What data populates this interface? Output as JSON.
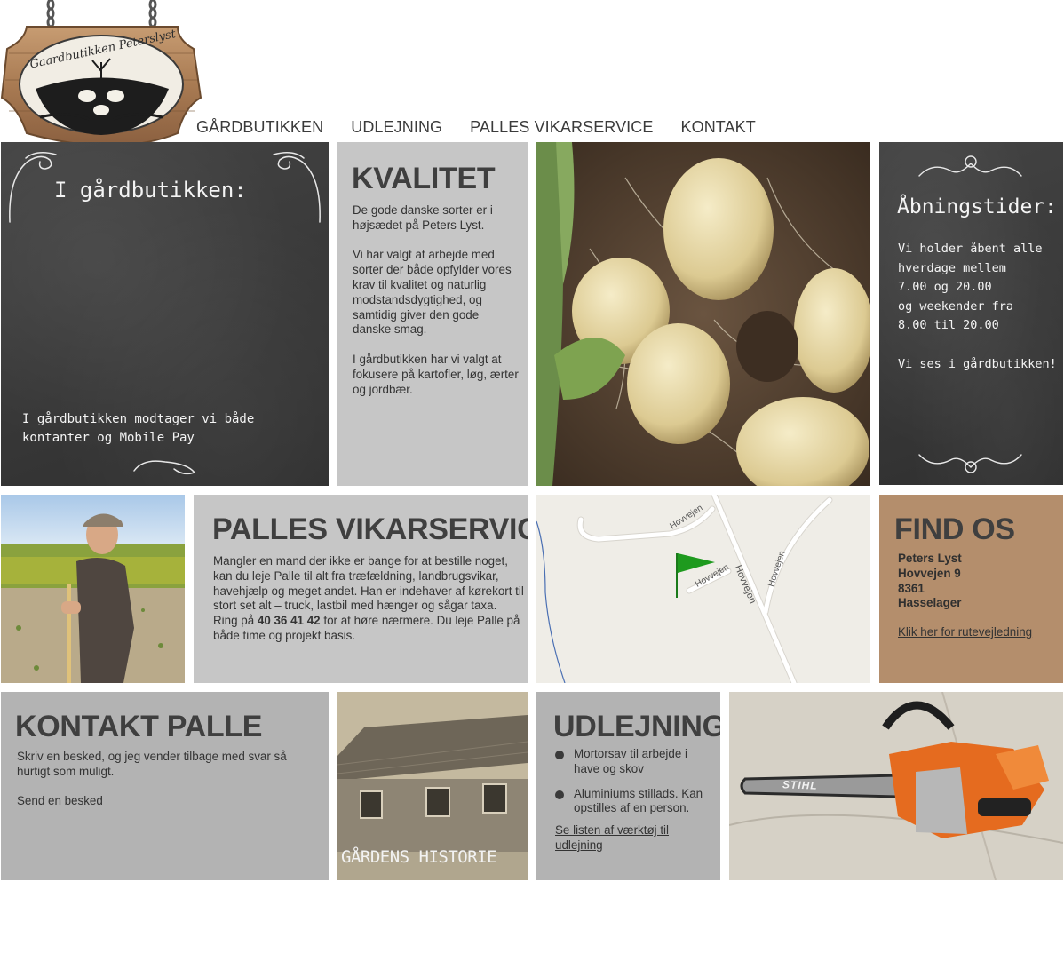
{
  "header": {
    "logo_text": "Gaardbutikken Peterslyst",
    "nav": [
      "GÅRDBUTIKKEN",
      "UDLEJNING",
      "PALLES VIKARSERVICE",
      "KONTAKT"
    ]
  },
  "gardbutik": {
    "title": "I gårdbutikken:",
    "payment": "I gårdbutikken modtager vi både kontanter og Mobile Pay"
  },
  "kvalitet": {
    "title": "KVALITET",
    "paragraphs": [
      "De gode danske sorter er i højsædet på Peters Lyst.",
      "Vi har valgt at arbejde med sorter der både opfylder vores krav til kvalitet og naturlig modstandsdygtighed, og samtidig giver den gode danske smag.",
      "I gårdbutikken har vi valgt at fokusere på kartofler, løg, ærter og jordbær."
    ]
  },
  "hours": {
    "title": "Åbningstider:",
    "lines": [
      "Vi holder åbent alle",
      "hverdage mellem",
      "7.00 og 20.00",
      "og weekender fra",
      "8.00 til 20.00"
    ],
    "closing": "Vi ses i gårdbutikken!"
  },
  "vikar": {
    "title": "PALLES VIKARSERVICE",
    "text": "Mangler en mand der ikke er bange for at bestille noget, kan du leje Palle til alt fra træfældning, landbrugsvikar, havehjælp og meget andet. Han er indehaver af kørekort til stort set alt – truck, lastbil med hænger og sågar taxa.",
    "ring_prefix": "Ring på ",
    "phone": "40 36 41 42",
    "ring_suffix": " for at høre nærmere. Du leje Palle på både time og projekt basis."
  },
  "map": {
    "road_labels": [
      "Hovvejen",
      "Hovvejen",
      "Hovvejen",
      "Hovvejen"
    ]
  },
  "find": {
    "title": "FIND OS",
    "address": [
      "Peters Lyst",
      "Hovvejen 9",
      "8361",
      "Hasselager"
    ],
    "link": "Klik her for rutevejledning"
  },
  "kontakt": {
    "title": "KONTAKT PALLE",
    "text": "Skriv en besked, og jeg vender tilbage med svar så hurtigt som muligt.",
    "link": "Send en besked"
  },
  "historie": {
    "label": "GÅRDENS HISTORIE"
  },
  "udlejning": {
    "title": "UDLEJNING",
    "items": [
      "Mortorsav til arbejde i have og skov",
      "Aluminiums stillads. Kan opstilles af en person."
    ],
    "link": "Se listen af værktøj til udlejning"
  },
  "chainsaw": {
    "brand": "STIHL"
  },
  "colors": {
    "gray_tile": "#c6c6c6",
    "gray_tile_dark": "#b3b3b3",
    "tan_tile": "#b48e6c",
    "chalkboard": "#3a3a3a",
    "map_flag": "#1e9a1e"
  }
}
